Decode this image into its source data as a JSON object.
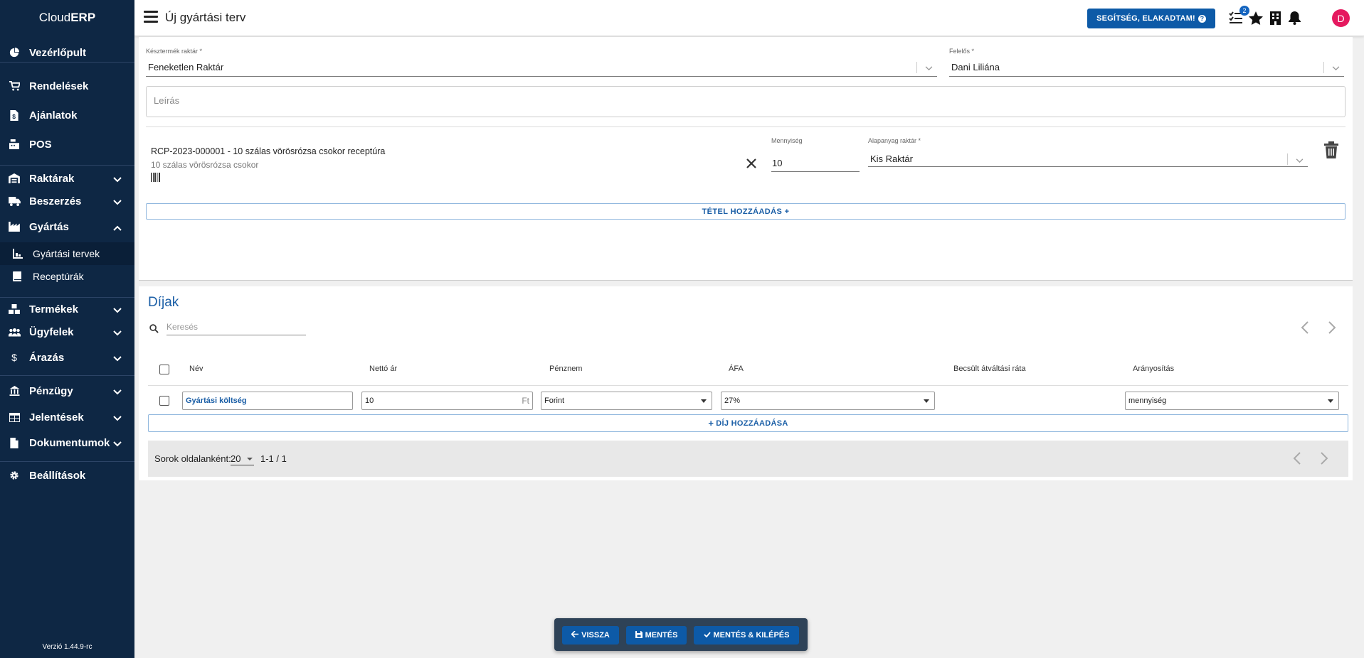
{
  "app": {
    "brand_light": "Cloud",
    "brand_bold": "ERP",
    "version": "Verzió 1.44.9-rc"
  },
  "sidebar": {
    "items": [
      {
        "label": "Vezérlőpult",
        "icon": "pie-chart-icon"
      },
      {
        "label": "Rendelések",
        "icon": "cart-icon"
      },
      {
        "label": "Ajánlatok",
        "icon": "document-dollar-icon"
      },
      {
        "label": "POS",
        "icon": "cash-register-icon"
      },
      {
        "label": "Raktárak",
        "icon": "warehouse-icon"
      },
      {
        "label": "Beszerzés",
        "icon": "truck-icon"
      },
      {
        "label": "Gyártás",
        "icon": "industry-icon"
      },
      {
        "label": "Termékek",
        "icon": "boxes-icon"
      },
      {
        "label": "Ügyfelek",
        "icon": "users-icon"
      },
      {
        "label": "Árazás",
        "icon": "dollar-icon"
      },
      {
        "label": "Pénzügy",
        "icon": "bank-icon"
      },
      {
        "label": "Jelentések",
        "icon": "table-icon"
      },
      {
        "label": "Dokumentumok",
        "icon": "file-icon"
      },
      {
        "label": "Beállítások",
        "icon": "gear-icon"
      }
    ],
    "sub_items": [
      {
        "label": "Gyártási tervek",
        "icon": "chart-bar-icon"
      },
      {
        "label": "Receptúrák",
        "icon": "book-icon"
      }
    ]
  },
  "topbar": {
    "title": "Új gyártási terv",
    "help_label": "SEGÍTSÉG, ELAKADTAM!",
    "tasks_badge": "2",
    "avatar_letter": "D"
  },
  "form": {
    "warehouse_label": "Késztermék raktár *",
    "warehouse_value": "Feneketlen Raktár",
    "responsible_label": "Felelős *",
    "responsible_value": "Dani Liliána",
    "description_placeholder": "Leírás"
  },
  "item": {
    "title": "RCP-2023-000001 - 10 szálas vörösrózsa csokor receptúra",
    "subtitle": "10 szálas vörösrózsa csokor",
    "qty_label": "Mennyiség",
    "qty_value": "10",
    "raw_wh_label": "Alapanyag raktár *",
    "raw_wh_value": "Kis Raktár",
    "add_label": "TÉTEL HOZZÁADÁS +"
  },
  "fees": {
    "title": "Díjak",
    "search_placeholder": "Keresés",
    "columns": [
      "Név",
      "Nettó ár",
      "Pénznem",
      "ÁFA",
      "Becsült átváltási ráta",
      "Arányosítás"
    ],
    "row": {
      "name": "Gyártási költség",
      "net": "10",
      "unit": "Ft",
      "currency": "Forint",
      "vat": "27%",
      "rate": "",
      "proportion": "mennyiség"
    },
    "add_label": "DÍJ HOZZÁADÁSA",
    "rows_per_page_label": "Sorok oldalanként:",
    "rows_per_page": "20",
    "range": "1-1 / 1"
  },
  "actions": {
    "back": "VISSZA",
    "save": "MENTÉS",
    "save_exit": "MENTÉS & KILÉPÉS"
  },
  "colors": {
    "sidebar": "#0e2744",
    "primary": "#0d5aa7",
    "avatar": "#e5195f"
  }
}
